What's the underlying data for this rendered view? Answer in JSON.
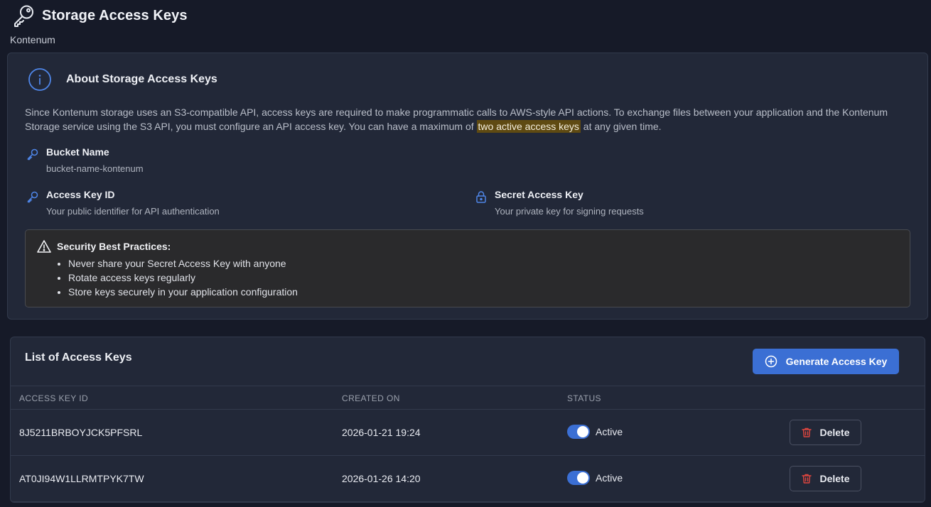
{
  "header": {
    "title": "Storage Access Keys",
    "subtitle": "Kontenum"
  },
  "about": {
    "title": "About Storage Access Keys",
    "desc_before": "Since Kontenum storage uses an S3-compatible API, access keys are required to make programmatic calls to AWS-style API actions. To exchange files between your application and the Kontenum Storage service using the S3 API, you must configure an API access key. You can have a maximum of ",
    "desc_highlight": "two active access keys",
    "desc_after": " at any given time.",
    "bucket": {
      "label": "Bucket Name",
      "value": "bucket-name-kontenum"
    },
    "access_key_id": {
      "label": "Access Key ID",
      "value": "Your public identifier for API authentication"
    },
    "secret_key": {
      "label": "Secret Access Key",
      "value": "Your private key for signing requests"
    },
    "security": {
      "title": "Security Best Practices:",
      "items": [
        "Never share your Secret Access Key with anyone",
        "Rotate access keys regularly",
        "Store keys securely in your application configuration"
      ]
    }
  },
  "keys": {
    "title": "List of Access Keys",
    "generate_label": "Generate Access Key",
    "columns": [
      "ACCESS KEY ID",
      "CREATED ON",
      "STATUS"
    ],
    "rows": [
      {
        "id": "8J5211BRBOYJCK5PFSRL",
        "created": "2026-01-21 19:24",
        "status": "Active",
        "delete_label": "Delete"
      },
      {
        "id": "AT0JI94W1LLRMTPYK7TW",
        "created": "2026-01-26 14:20",
        "status": "Active",
        "delete_label": "Delete"
      }
    ]
  },
  "colors": {
    "accent": "#3b6fd4",
    "background": "#161a28",
    "card": "#222838",
    "highlight": "#5f4a12",
    "danger": "#e0463f"
  }
}
